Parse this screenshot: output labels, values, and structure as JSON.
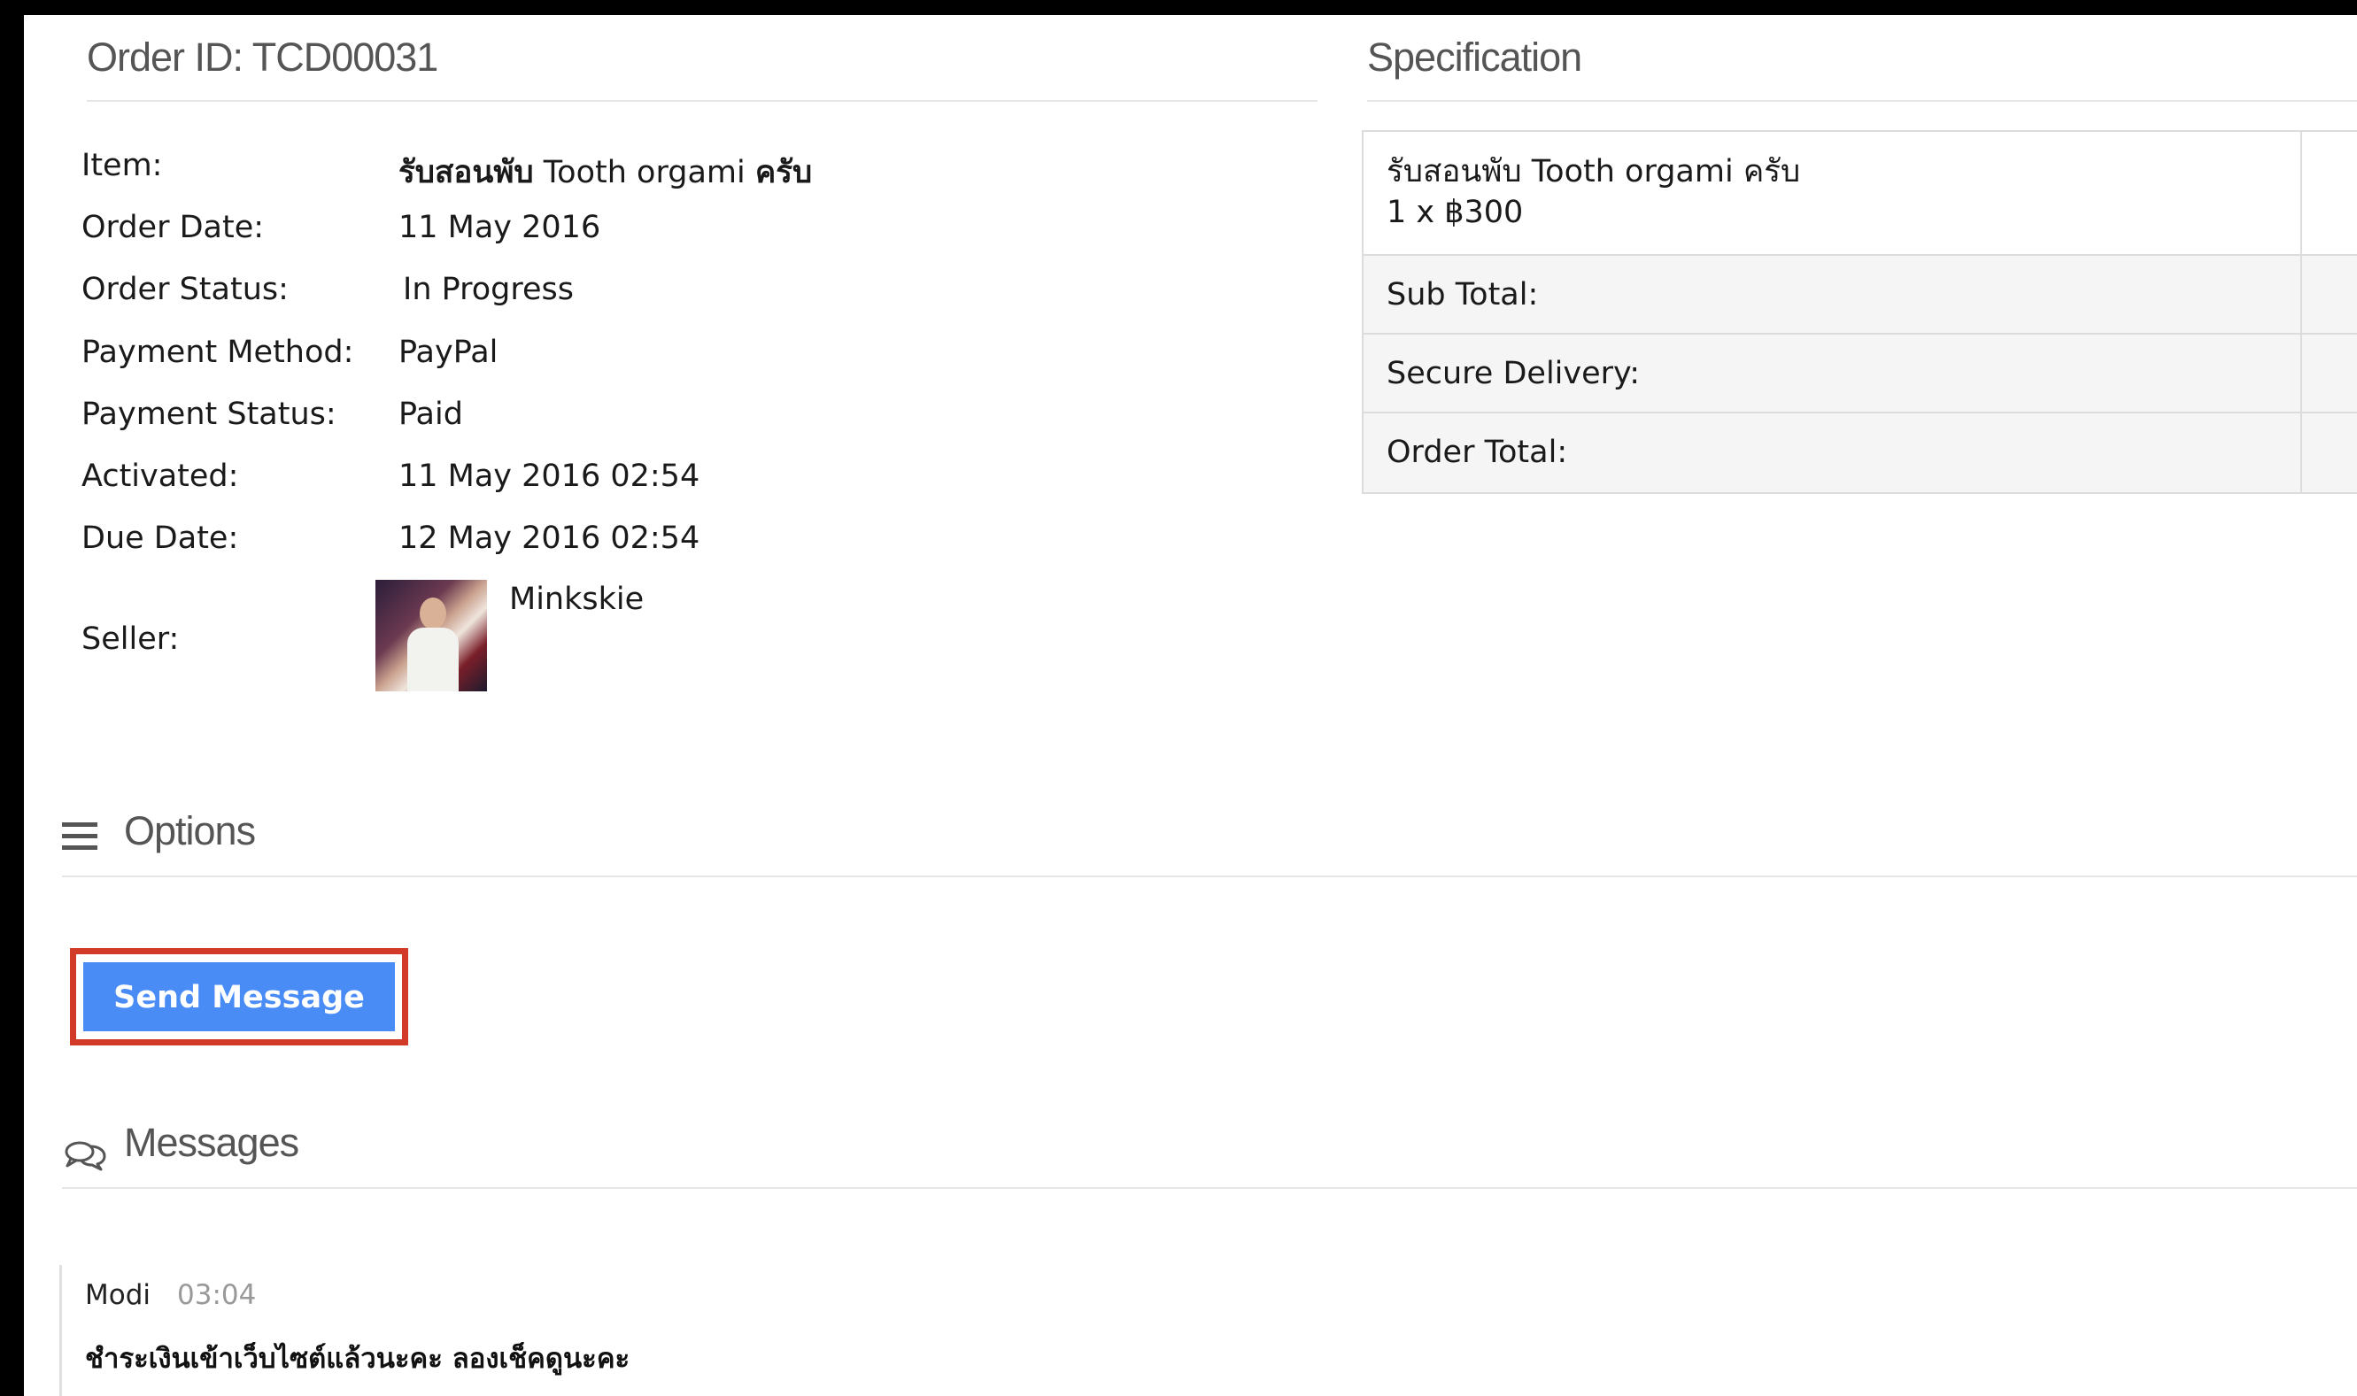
{
  "order": {
    "id_label": "Order ID: TCD00031"
  },
  "details": {
    "item_label": "Item:",
    "item_thai_prefix": "รับสอนพับ",
    "item_name": " Tooth orgami ",
    "item_thai_suffix": "ครับ",
    "order_date_label": "Order Date:",
    "order_date": "11 May 2016",
    "order_status_label": "Order Status:",
    "order_status": "In Progress",
    "payment_method_label": "Payment Method:",
    "payment_method": "PayPal",
    "payment_status_label": "Payment Status:",
    "payment_status": "Paid",
    "activated_label": "Activated:",
    "activated": "11 May 2016 02:54",
    "due_date_label": "Due Date:",
    "due_date": "12 May 2016 02:54",
    "seller_label": "Seller:",
    "seller_name": "Minkskie"
  },
  "specification": {
    "title": "Specification",
    "item_line1": "รับสอนพับ Tooth orgami ครับ",
    "item_line2": "1 x ฿300",
    "sub_total_label": "Sub Total:",
    "secure_delivery_label": "Secure Delivery:",
    "order_total_label": "Order Total:"
  },
  "options": {
    "title": "Options",
    "send_message_label": "Send Message"
  },
  "messages": {
    "title": "Messages",
    "items": [
      {
        "author": "Modi",
        "time": "03:04",
        "text": "ชำระเงินเข้าเว็บไซต์แล้วนะคะ ลองเช็คดูนะคะ"
      }
    ]
  },
  "colors": {
    "button": "#4a8cf6",
    "highlight_outline": "#d03a26"
  },
  "icons": {
    "options": "menu-icon",
    "messages": "chat-bubbles-icon"
  }
}
